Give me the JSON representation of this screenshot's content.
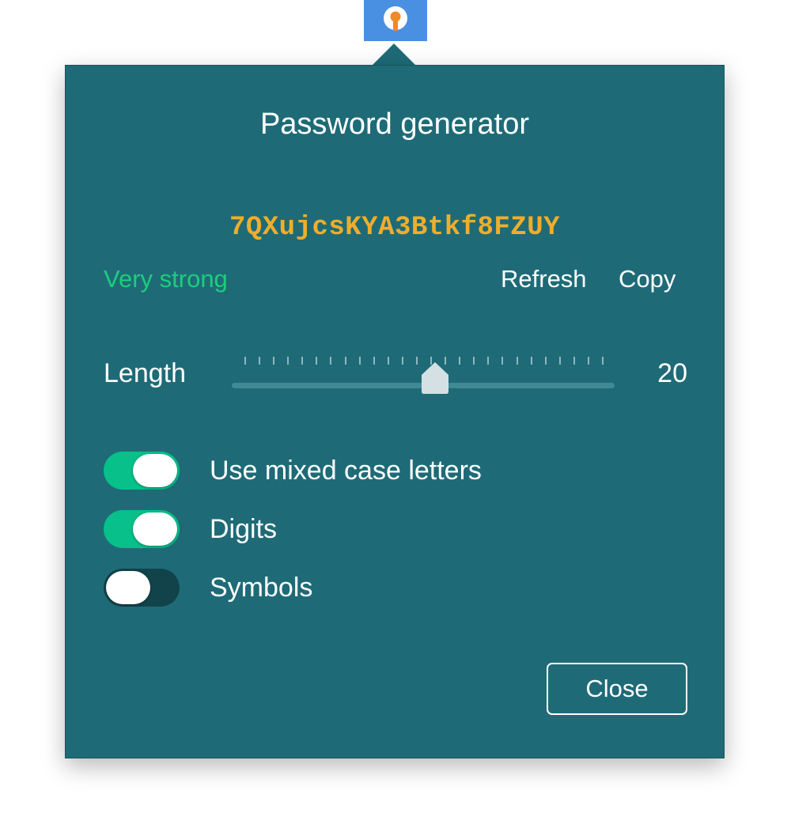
{
  "app": {
    "tray_icon": "keyhole-icon",
    "accent_color": "#4a90e2"
  },
  "popover": {
    "title": "Password generator",
    "background_color": "#1e6b77",
    "password": {
      "value": "7QXujcsKYA3Btkf8FZUY",
      "color": "#f0ad2b"
    },
    "strength": {
      "label": "Very strong",
      "color": "#1fcc7c"
    },
    "actions": {
      "refresh_label": "Refresh",
      "copy_label": "Copy"
    },
    "length": {
      "label": "Length",
      "value": "20",
      "slider_fraction": 0.53,
      "tick_count": 26
    },
    "options": [
      {
        "label": "Use mixed case letters",
        "enabled": true
      },
      {
        "label": "Digits",
        "enabled": true
      },
      {
        "label": "Symbols",
        "enabled": false
      }
    ],
    "close_label": "Close"
  }
}
